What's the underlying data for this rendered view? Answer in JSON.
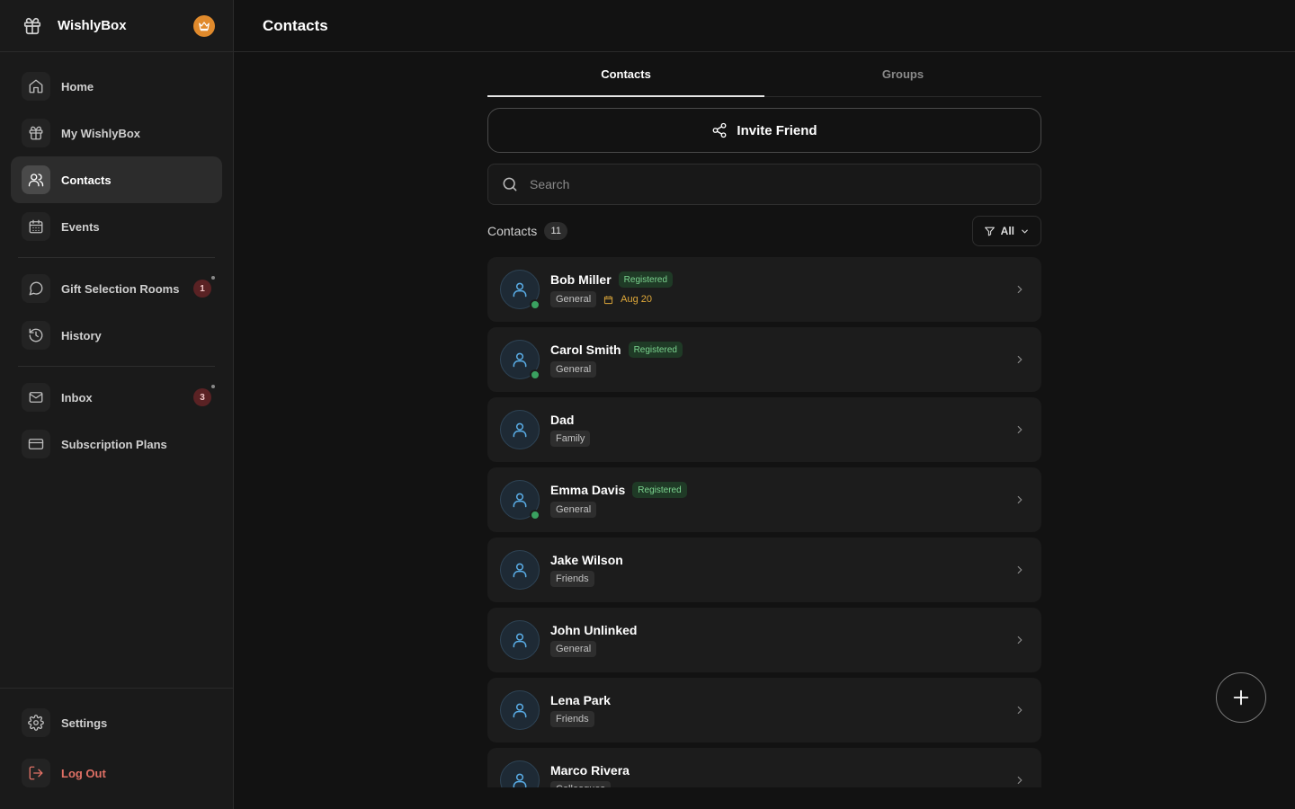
{
  "app": {
    "name": "WishlyBox"
  },
  "sidebar": {
    "items": [
      {
        "label": "Home",
        "icon": "home-icon"
      },
      {
        "label": "My WishlyBox",
        "icon": "gift-icon"
      },
      {
        "label": "Contacts",
        "icon": "users-icon",
        "active": true
      },
      {
        "label": "Events",
        "icon": "calendar-icon"
      },
      {
        "label": "Gift Selection Rooms",
        "icon": "chat-icon",
        "badge": "1"
      },
      {
        "label": "History",
        "icon": "history-icon"
      },
      {
        "label": "Inbox",
        "icon": "mail-icon",
        "badge": "3"
      },
      {
        "label": "Subscription Plans",
        "icon": "credit-card-icon"
      }
    ],
    "footer": {
      "settings": "Settings",
      "logout": "Log Out"
    }
  },
  "header": {
    "title": "Contacts"
  },
  "tabs": [
    {
      "label": "Contacts",
      "active": true
    },
    {
      "label": "Groups",
      "active": false
    }
  ],
  "invite": {
    "label": "Invite Friend"
  },
  "search": {
    "placeholder": "Search"
  },
  "list": {
    "title": "Contacts",
    "count": "11",
    "filter_label": "All"
  },
  "contacts": [
    {
      "name": "Bob Miller",
      "registered": "Registered",
      "group": "General",
      "date": "Aug 20",
      "online": true
    },
    {
      "name": "Carol Smith",
      "registered": "Registered",
      "group": "General",
      "online": true
    },
    {
      "name": "Dad",
      "group": "Family"
    },
    {
      "name": "Emma Davis",
      "registered": "Registered",
      "group": "General",
      "online": true
    },
    {
      "name": "Jake Wilson",
      "group": "Friends"
    },
    {
      "name": "John Unlinked",
      "group": "General"
    },
    {
      "name": "Lena Park",
      "group": "Friends"
    },
    {
      "name": "Marco Rivera",
      "group": "Colleagues"
    }
  ],
  "colors": {
    "accent_registered": "#7bd48f",
    "date_color": "#e0a93a",
    "logout_color": "#e07065",
    "badge_bg": "#5a2224",
    "crown_bg": "#e08a2c"
  }
}
